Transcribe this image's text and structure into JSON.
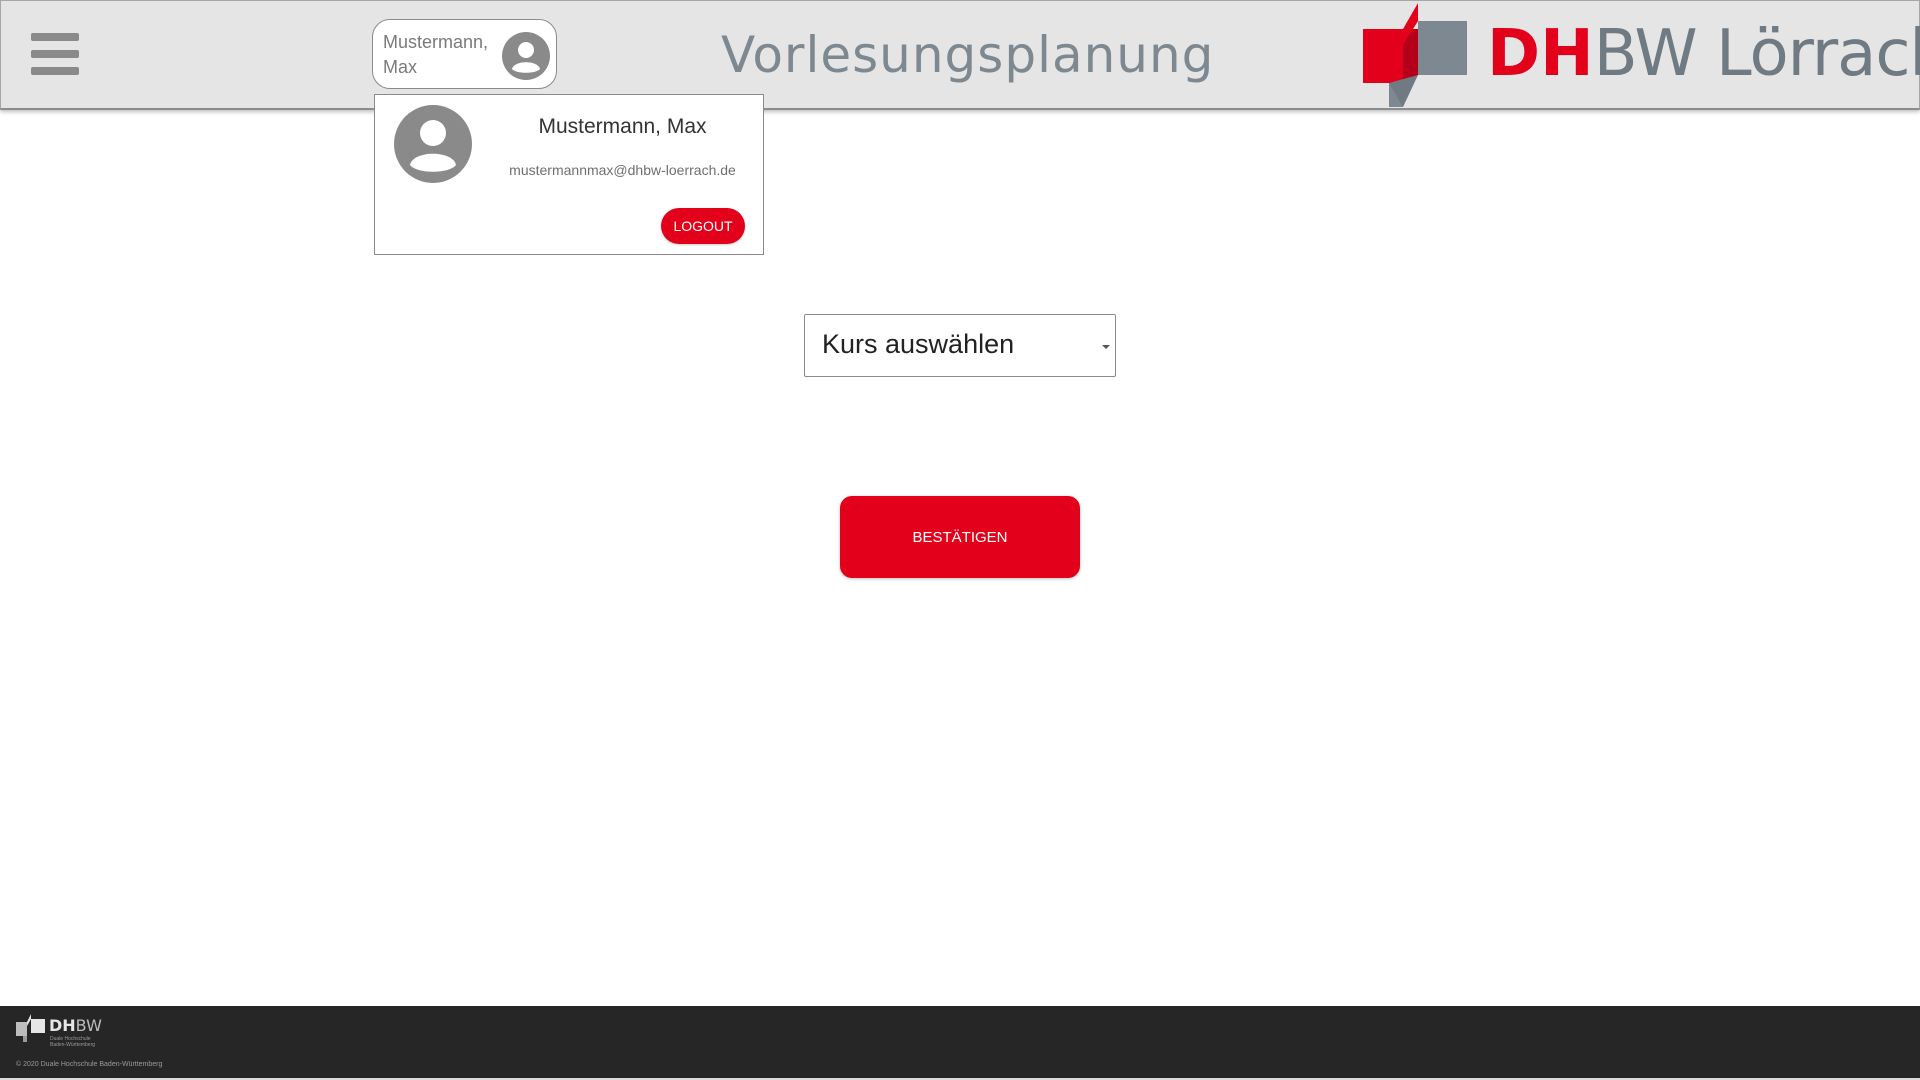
{
  "header": {
    "title": "Vorlesungsplanung",
    "menu_icon": "hamburger-menu-icon",
    "user_button": {
      "name": "Mustermann, Max",
      "icon": "user-avatar-icon"
    },
    "brand": {
      "name_red": "DH",
      "name_grey": "BW Lörrach",
      "logo_icon": "dhbw-logo-icon"
    }
  },
  "user_dropdown": {
    "name": "Mustermann, Max",
    "email": "mustermannmax@dhbw-loerrach.de",
    "avatar_icon": "user-avatar-icon",
    "logout_label": "LOGOUT"
  },
  "course_select": {
    "placeholder": "Kurs auswählen",
    "caret_icon": "chevron-down-icon"
  },
  "confirm_label": "BESTÄTIGEN",
  "footer": {
    "brand_bold": "DH",
    "brand_light": "BW",
    "brand_sub": "Duale Hochschule\nBaden-Württemberg",
    "copyright": "© 2020 Duale Hochschule Baden-Württemberg"
  },
  "colors": {
    "accent_red": "#e2001a",
    "header_bg": "#e5e5e5",
    "footer_bg": "#262626",
    "brand_grey": "#6f7a82"
  }
}
